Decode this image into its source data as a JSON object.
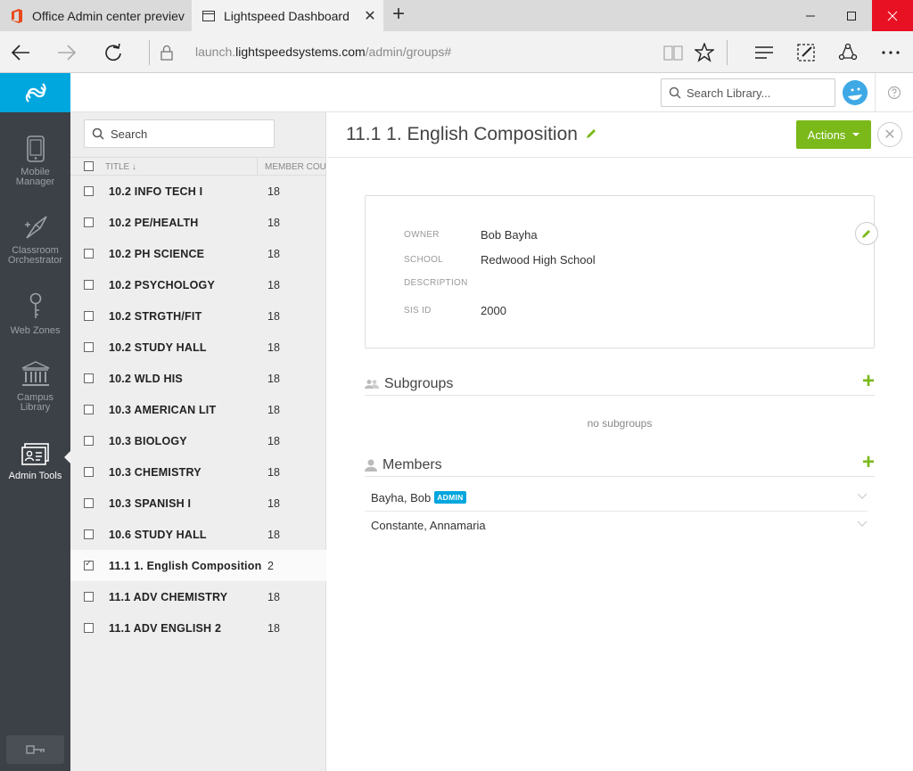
{
  "browser": {
    "tabs": [
      {
        "label": "Office Admin center previev",
        "active": false
      },
      {
        "label": "Lightspeed Dashboard",
        "active": true
      }
    ],
    "url_prefix": "launch.",
    "url_domain": "lightspeedsystems.com",
    "url_path": "/admin/groups#"
  },
  "rail": {
    "items": [
      {
        "label_line1": "Mobile",
        "label_line2": "Manager",
        "icon": "mobile-icon"
      },
      {
        "label_line1": "Classroom",
        "label_line2": "Orchestrator",
        "icon": "compass-icon"
      },
      {
        "label_line1": "Web Zones",
        "label_line2": "",
        "icon": "key-icon"
      },
      {
        "label_line1": "Campus",
        "label_line2": "Library",
        "icon": "library-icon"
      },
      {
        "label_line1": "Admin Tools",
        "label_line2": "",
        "icon": "id-card-icon",
        "active": true
      }
    ]
  },
  "header": {
    "library_search_placeholder": "Search Library..."
  },
  "groups": {
    "search_placeholder": "Search",
    "col_title": "TITLE",
    "col_count": "MEMBER COUNT",
    "rows": [
      {
        "name": "10.2 INFO TECH I",
        "count": "18"
      },
      {
        "name": "10.2 PE/HEALTH",
        "count": "18"
      },
      {
        "name": "10.2 PH SCIENCE",
        "count": "18"
      },
      {
        "name": "10.2 PSYCHOLOGY",
        "count": "18"
      },
      {
        "name": "10.2 STRGTH/FIT",
        "count": "18"
      },
      {
        "name": "10.2 STUDY HALL",
        "count": "18"
      },
      {
        "name": "10.2 WLD HIS",
        "count": "18"
      },
      {
        "name": "10.3 AMERICAN LIT",
        "count": "18"
      },
      {
        "name": "10.3 BIOLOGY",
        "count": "18"
      },
      {
        "name": "10.3 CHEMISTRY",
        "count": "18"
      },
      {
        "name": "10.3 SPANISH I",
        "count": "18"
      },
      {
        "name": "10.6 STUDY HALL",
        "count": "18"
      },
      {
        "name": "11.1 1. English Composition",
        "count": "2",
        "selected": true
      },
      {
        "name": "11.1 ADV CHEMISTRY",
        "count": "18"
      },
      {
        "name": "11.1 ADV ENGLISH 2",
        "count": "18"
      }
    ]
  },
  "detail": {
    "title": "11.1 1. English Composition",
    "actions_label": "Actions",
    "info": {
      "owner_label": "OWNER",
      "owner": "Bob Bayha",
      "school_label": "SCHOOL",
      "school": "Redwood High School",
      "description_label": "DESCRIPTION",
      "description": "",
      "sisid_label": "SIS ID",
      "sisid": "2000"
    },
    "subgroups_title": "Subgroups",
    "subgroups_empty": "no subgroups",
    "members_title": "Members",
    "members": [
      {
        "name": "Bayha, Bob",
        "badge": "ADMIN"
      },
      {
        "name": "Constante, Annamaria",
        "badge": ""
      }
    ]
  },
  "colors": {
    "accent_blue": "#00a6de",
    "accent_green": "#7ab919",
    "rail_bg": "#3c4147"
  }
}
